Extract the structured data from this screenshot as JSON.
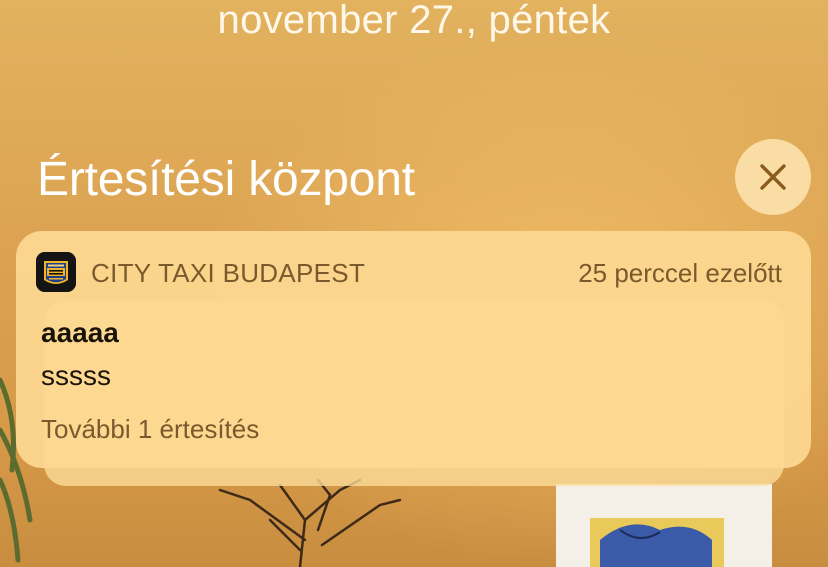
{
  "lockscreen": {
    "date": "november 27., péntek"
  },
  "notification_center": {
    "title": "Értesítési központ",
    "close_icon": "close-x-icon"
  },
  "notification": {
    "app_name": "CITY TAXI BUDAPEST",
    "app_icon": "city-taxi-app-icon",
    "time_ago": "25 perccel ezelőtt",
    "title": "aaaaa",
    "body": "sssss",
    "more": "További 1 értesítés"
  },
  "colors": {
    "wallpaper": "#dca452",
    "card": "#fdd891",
    "close_button": "#ffe8b4",
    "close_glyph": "#8a5a1e",
    "secondary_text": "#7a5a2c"
  }
}
